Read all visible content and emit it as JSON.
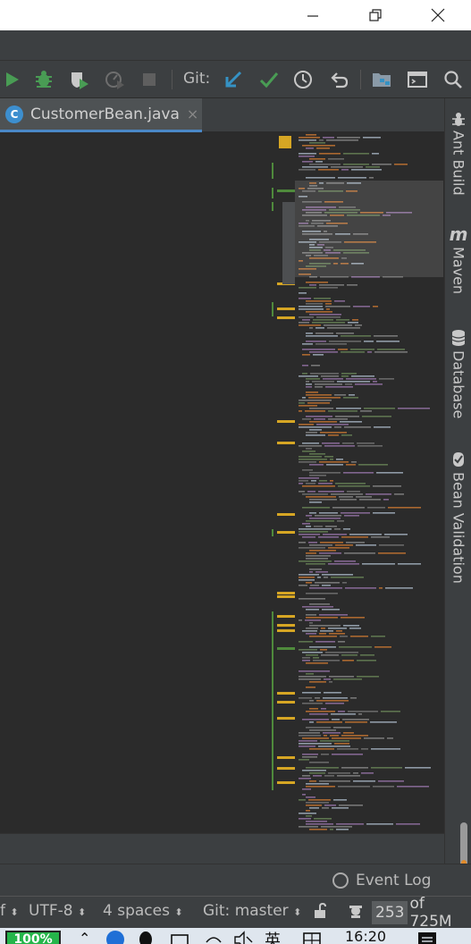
{
  "window": {
    "controls": [
      "minimize",
      "maximize",
      "close"
    ]
  },
  "toolbar": {
    "git_label": "Git:",
    "icons": [
      "run-icon",
      "debug-icon",
      "coverage-icon",
      "profile-icon",
      "stop-icon",
      "vcs-update-icon",
      "vcs-commit-icon",
      "history-icon",
      "rollback-icon",
      "project-structure-icon",
      "terminal-icon",
      "search-icon"
    ]
  },
  "tab": {
    "icon_letter": "C",
    "label": "CustomerBean.java",
    "close": "×"
  },
  "right_tools": {
    "ant": "Ant Build",
    "maven_letter": "m",
    "maven": "Maven",
    "database": "Database",
    "bean": "Bean Validation"
  },
  "bottom": {
    "event_log": "Event Log"
  },
  "status": {
    "encoding": "UTF-8",
    "indent": "4 spaces",
    "git_branch": "Git: master",
    "mem_used": "253",
    "mem_total": "of 725M",
    "arrow": "⬍",
    "left_fragment": "f"
  },
  "taskbar": {
    "battery": "100%",
    "ime": "英",
    "clock": "16:20"
  },
  "colors": {
    "accent_blue": "#4a88c7",
    "run_green": "#499c54",
    "marker_yellow": "#d6a624",
    "change_green": "#4f8a3c",
    "battery_green": "#25b54a"
  }
}
